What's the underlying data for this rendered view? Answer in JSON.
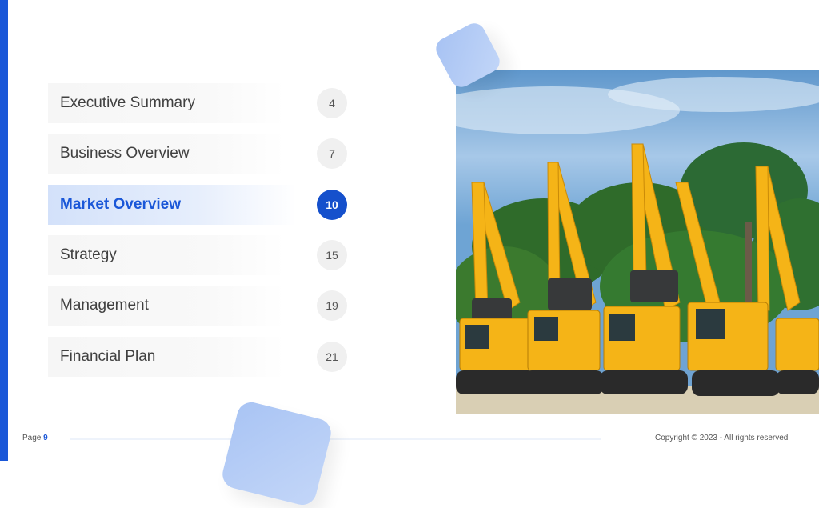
{
  "toc": {
    "items": [
      {
        "label": "Executive Summary",
        "page": "4",
        "active": false
      },
      {
        "label": "Business Overview",
        "page": "7",
        "active": false
      },
      {
        "label": "Market Overview",
        "page": "10",
        "active": true
      },
      {
        "label": "Strategy",
        "page": "15",
        "active": false
      },
      {
        "label": "Management",
        "page": "19",
        "active": false
      },
      {
        "label": "Financial Plan",
        "page": "21",
        "active": false
      }
    ]
  },
  "photo": {
    "description": "Row of yellow excavators in front of palm trees under a blue sky"
  },
  "footer": {
    "page_label": "Page",
    "page_number": "9",
    "copyright": "Copyright © 2023 - All rights reserved"
  },
  "colors": {
    "accent": "#1a57d8",
    "active_bg": "#d3e1fa",
    "badge_bg": "#f0f0f0"
  }
}
